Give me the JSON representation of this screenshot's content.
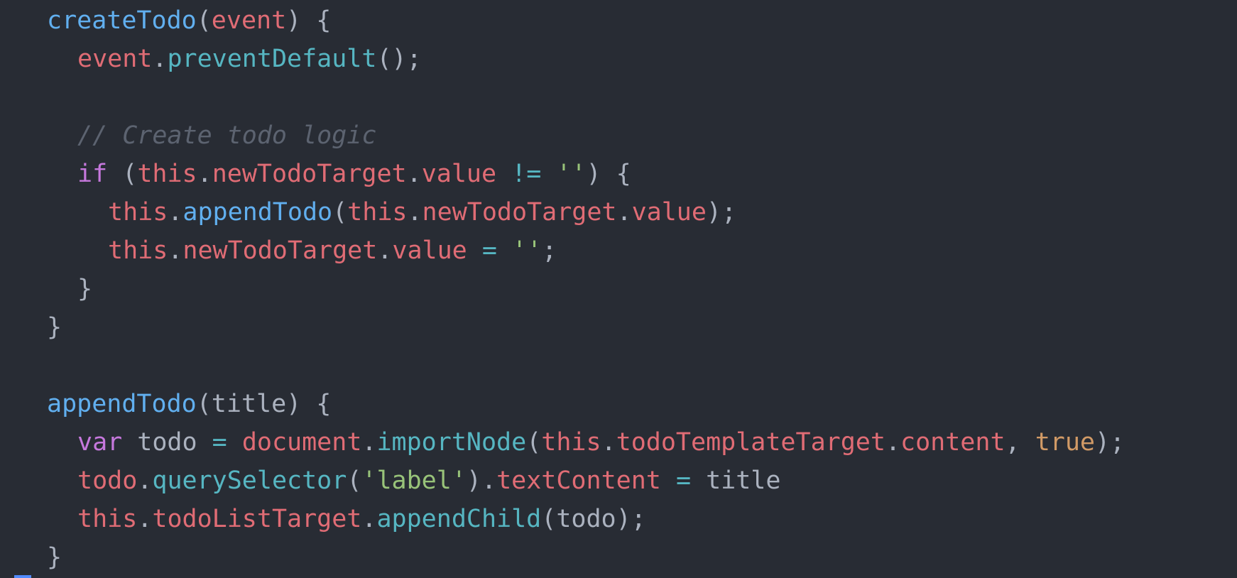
{
  "editor": {
    "lines": [
      {
        "indent": 0,
        "tokens": [
          {
            "t": "func",
            "v": "createTodo"
          },
          {
            "t": "punc",
            "v": "("
          },
          {
            "t": "var",
            "v": "event"
          },
          {
            "t": "punc",
            "v": ") {"
          }
        ]
      },
      {
        "indent": 1,
        "tokens": [
          {
            "t": "var",
            "v": "event"
          },
          {
            "t": "punc",
            "v": "."
          },
          {
            "t": "method",
            "v": "preventDefault"
          },
          {
            "t": "punc",
            "v": "();"
          }
        ]
      },
      {
        "indent": 0,
        "tokens": []
      },
      {
        "indent": 1,
        "tokens": [
          {
            "t": "comment",
            "v": "// Create todo logic"
          }
        ]
      },
      {
        "indent": 1,
        "tokens": [
          {
            "t": "kw",
            "v": "if"
          },
          {
            "t": "punc",
            "v": " ("
          },
          {
            "t": "var",
            "v": "this"
          },
          {
            "t": "punc",
            "v": "."
          },
          {
            "t": "var",
            "v": "newTodoTarget"
          },
          {
            "t": "punc",
            "v": "."
          },
          {
            "t": "var",
            "v": "value"
          },
          {
            "t": "plain",
            "v": " "
          },
          {
            "t": "op",
            "v": "!="
          },
          {
            "t": "plain",
            "v": " "
          },
          {
            "t": "str",
            "v": "''"
          },
          {
            "t": "punc",
            "v": ") {"
          }
        ]
      },
      {
        "indent": 2,
        "tokens": [
          {
            "t": "var",
            "v": "this"
          },
          {
            "t": "punc",
            "v": "."
          },
          {
            "t": "func",
            "v": "appendTodo"
          },
          {
            "t": "punc",
            "v": "("
          },
          {
            "t": "var",
            "v": "this"
          },
          {
            "t": "punc",
            "v": "."
          },
          {
            "t": "var",
            "v": "newTodoTarget"
          },
          {
            "t": "punc",
            "v": "."
          },
          {
            "t": "var",
            "v": "value"
          },
          {
            "t": "punc",
            "v": ");"
          }
        ]
      },
      {
        "indent": 2,
        "tokens": [
          {
            "t": "var",
            "v": "this"
          },
          {
            "t": "punc",
            "v": "."
          },
          {
            "t": "var",
            "v": "newTodoTarget"
          },
          {
            "t": "punc",
            "v": "."
          },
          {
            "t": "var",
            "v": "value"
          },
          {
            "t": "plain",
            "v": " "
          },
          {
            "t": "op",
            "v": "="
          },
          {
            "t": "plain",
            "v": " "
          },
          {
            "t": "str",
            "v": "''"
          },
          {
            "t": "punc",
            "v": ";"
          }
        ]
      },
      {
        "indent": 1,
        "tokens": [
          {
            "t": "punc",
            "v": "}"
          }
        ]
      },
      {
        "indent": 0,
        "tokens": [
          {
            "t": "punc",
            "v": "}"
          }
        ]
      },
      {
        "indent": 0,
        "tokens": []
      },
      {
        "indent": 0,
        "tokens": [
          {
            "t": "func",
            "v": "appendTodo"
          },
          {
            "t": "punc",
            "v": "("
          },
          {
            "t": "plain",
            "v": "title"
          },
          {
            "t": "punc",
            "v": ") {"
          }
        ]
      },
      {
        "indent": 1,
        "tokens": [
          {
            "t": "kw",
            "v": "var"
          },
          {
            "t": "plain",
            "v": " todo "
          },
          {
            "t": "op",
            "v": "="
          },
          {
            "t": "plain",
            "v": " "
          },
          {
            "t": "var",
            "v": "document"
          },
          {
            "t": "punc",
            "v": "."
          },
          {
            "t": "method",
            "v": "importNode"
          },
          {
            "t": "punc",
            "v": "("
          },
          {
            "t": "var",
            "v": "this"
          },
          {
            "t": "punc",
            "v": "."
          },
          {
            "t": "var",
            "v": "todoTemplateTarget"
          },
          {
            "t": "punc",
            "v": "."
          },
          {
            "t": "var",
            "v": "content"
          },
          {
            "t": "punc",
            "v": ", "
          },
          {
            "t": "bool",
            "v": "true"
          },
          {
            "t": "punc",
            "v": ");"
          }
        ]
      },
      {
        "indent": 1,
        "tokens": [
          {
            "t": "var",
            "v": "todo"
          },
          {
            "t": "punc",
            "v": "."
          },
          {
            "t": "method",
            "v": "querySelector"
          },
          {
            "t": "punc",
            "v": "("
          },
          {
            "t": "str",
            "v": "'label'"
          },
          {
            "t": "punc",
            "v": ")."
          },
          {
            "t": "var",
            "v": "textContent"
          },
          {
            "t": "plain",
            "v": " "
          },
          {
            "t": "op",
            "v": "="
          },
          {
            "t": "plain",
            "v": " title"
          }
        ]
      },
      {
        "indent": 1,
        "tokens": [
          {
            "t": "var",
            "v": "this"
          },
          {
            "t": "punc",
            "v": "."
          },
          {
            "t": "var",
            "v": "todoListTarget"
          },
          {
            "t": "punc",
            "v": "."
          },
          {
            "t": "method",
            "v": "appendChild"
          },
          {
            "t": "punc",
            "v": "("
          },
          {
            "t": "plain",
            "v": "todo"
          },
          {
            "t": "punc",
            "v": ");"
          }
        ]
      },
      {
        "indent": 0,
        "tokens": [
          {
            "t": "punc",
            "v": "}"
          }
        ]
      }
    ]
  },
  "theme": {
    "background": "#282c34",
    "function": "#61afef",
    "method": "#56b6c2",
    "variable": "#e06c75",
    "keyword": "#c678dd",
    "string": "#98c379",
    "boolean": "#d19a66",
    "punctuation": "#abb2bf",
    "comment": "#5c6370"
  }
}
